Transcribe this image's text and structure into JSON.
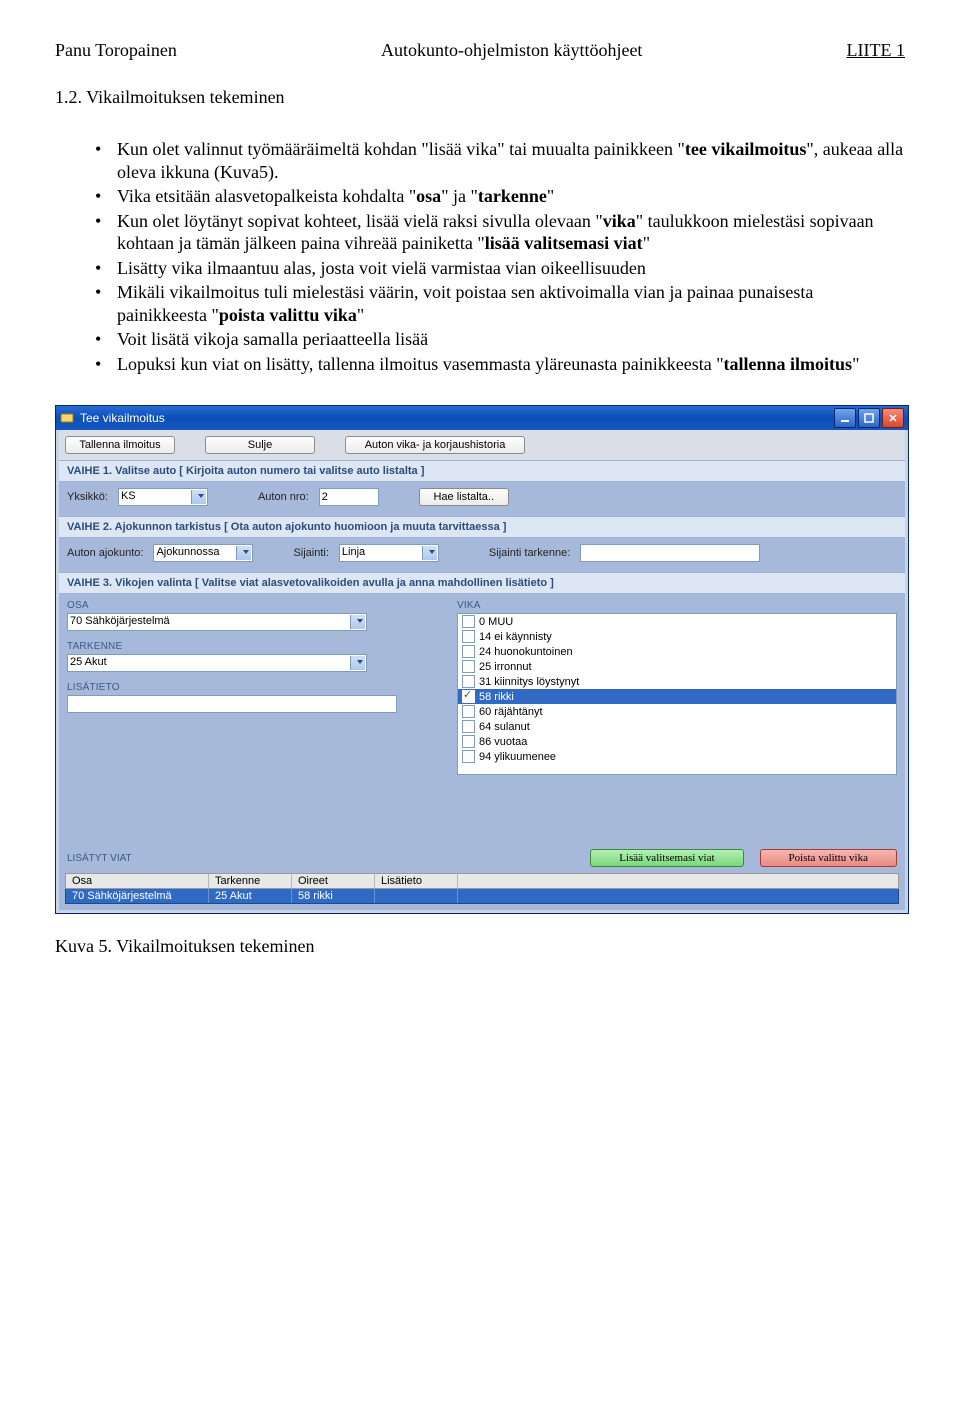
{
  "header": {
    "left": "Panu Toropainen",
    "center": "Autokunto-ohjelmiston käyttöohjeet",
    "right": "LIITE 1"
  },
  "section_title": "1.2. Vikailmoituksen tekeminen",
  "bullets": {
    "b1a": "Kun olet valinnut työmääräimeltä kohdan \"lisää vika\" tai muualta painikkeen \"",
    "b1b": "tee vikailmoitus",
    "b1c": "\", aukeaa alla oleva ikkuna (Kuva5).",
    "b2a": "Vika etsitään alasvetopalkeista kohdalta \"",
    "b2b": "osa",
    "b2c": "\" ja \"",
    "b2d": "tarkenne",
    "b2e": "\"",
    "b3a": "Kun olet löytänyt sopivat kohteet, lisää vielä raksi sivulla olevaan \"",
    "b3b": "vika",
    "b3c": "\" taulukkoon mielestäsi sopivaan kohtaan ja tämän jälkeen paina vihreää painiketta \"",
    "b3d": "lisää valitsemasi viat",
    "b3e": "\"",
    "b4": "Lisätty vika ilmaantuu alas, josta voit vielä varmistaa vian oikeellisuuden",
    "b5a": "Mikäli vikailmoitus tuli mielestäsi väärin, voit poistaa sen aktivoimalla vian ja painaa punaisesta painikkeesta \"",
    "b5b": "poista valittu vika",
    "b5c": "\"",
    "b6": "Voit lisätä vikoja samalla periaatteella lisää",
    "b7a": "Lopuksi kun viat on lisätty, tallenna ilmoitus vasemmasta yläreunasta painikkeesta \"",
    "b7b": "tallenna ilmoitus",
    "b7c": "\""
  },
  "window": {
    "title": "Tee vikailmoitus",
    "toolbar": {
      "save": "Tallenna ilmoitus",
      "close": "Sulje",
      "history": "Auton vika- ja korjaushistoria"
    },
    "stage1": {
      "bar": "VAIHE 1. Valitse auto [ Kirjoita auton numero tai valitse auto listalta ]",
      "yksikko_label": "Yksikkö:",
      "yksikko_value": "KS",
      "auton_nro_label": "Auton nro:",
      "auton_nro_value": "2",
      "hae_button": "Hae listalta.."
    },
    "stage2": {
      "bar": "VAIHE 2. Ajokunnon tarkistus [ Ota auton ajokunto huomioon ja muuta tarvittaessa ]",
      "ajokunto_label": "Auton ajokunto:",
      "ajokunto_value": "Ajokunnossa",
      "sijainti_label": "Sijainti:",
      "sijainti_value": "Linja",
      "tarkenne_label": "Sijainti tarkenne:",
      "tarkenne_value": ""
    },
    "stage3": {
      "bar": "VAIHE 3. Vikojen valinta [ Valitse viat alasvetovalikoiden avulla ja anna mahdollinen lisätieto ]",
      "osa_head": "OSA",
      "osa_value": "70 Sähköjärjestelmä",
      "tarkenne_head": "TARKENNE",
      "tarkenne_value": "25 Akut",
      "lisatieto_head": "LISÄTIETO",
      "vika_head": "VIKA",
      "vika_items": [
        {
          "label": "0 MUU",
          "checked": false
        },
        {
          "label": "14 ei käynnisty",
          "checked": false
        },
        {
          "label": "24 huonokuntoinen",
          "checked": false
        },
        {
          "label": "25 irronnut",
          "checked": false
        },
        {
          "label": "31 kiinnitys löystynyt",
          "checked": false
        },
        {
          "label": "58 rikki",
          "checked": true,
          "selected": true
        },
        {
          "label": "60 räjähtänyt",
          "checked": false
        },
        {
          "label": "64 sulanut",
          "checked": false
        },
        {
          "label": "86 vuotaa",
          "checked": false
        },
        {
          "label": "94 ylikuumenee",
          "checked": false
        }
      ]
    },
    "footer": {
      "label": "LISÄTYT VIAT",
      "add": "Lisää valitsemasi viat",
      "remove": "Poista valittu vika"
    },
    "grid": {
      "h_osa": "Osa",
      "h_tark": "Tarkenne",
      "h_oir": "Oireet",
      "h_lis": "Lisätieto",
      "row": {
        "osa": "70 Sähköjärjestelmä",
        "tark": "25 Akut",
        "oir": "58 rikki",
        "lis": ""
      }
    }
  },
  "caption": "Kuva 5. Vikailmoituksen tekeminen"
}
